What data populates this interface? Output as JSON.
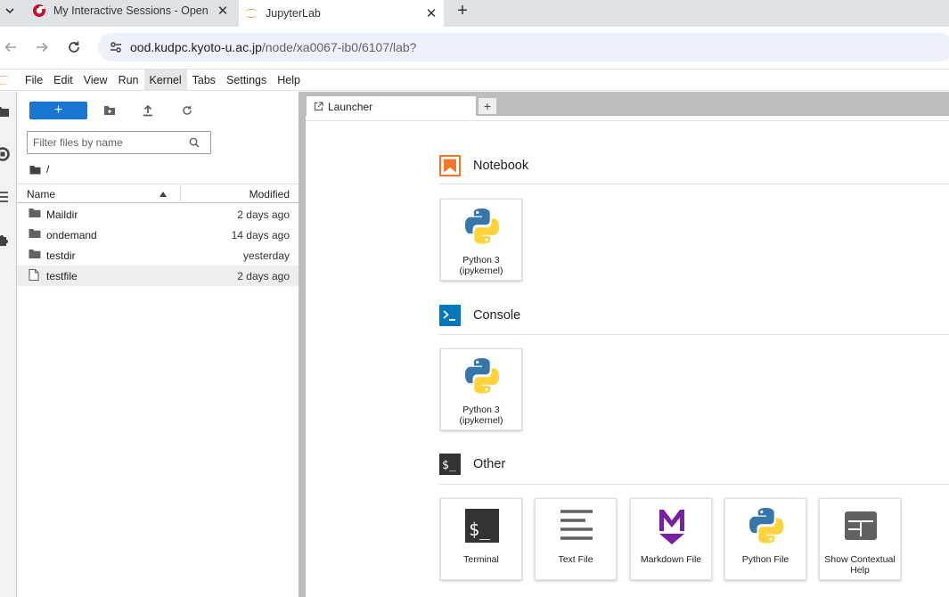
{
  "browser": {
    "tabs": [
      {
        "title": "My Interactive Sessions - Open",
        "active": false
      },
      {
        "title": "JupyterLab",
        "active": true
      }
    ],
    "url_host": "ood.kudpc.kyoto-u.ac.jp",
    "url_path": "/node/xa0067-ib0/6107/lab?"
  },
  "menubar": {
    "items": [
      "File",
      "Edit",
      "View",
      "Run",
      "Kernel",
      "Tabs",
      "Settings",
      "Help"
    ],
    "active": "Kernel"
  },
  "filebrowser": {
    "new_label": "+",
    "filter_placeholder": "Filter files by name",
    "breadcrumb": "/",
    "columns": {
      "name": "Name",
      "modified": "Modified"
    },
    "files": [
      {
        "name": "Maildir",
        "type": "folder",
        "modified": "2 days ago"
      },
      {
        "name": "ondemand",
        "type": "folder",
        "modified": "14 days ago"
      },
      {
        "name": "testdir",
        "type": "folder",
        "modified": "yesterday"
      },
      {
        "name": "testfile",
        "type": "file",
        "modified": "2 days ago",
        "selected": true
      }
    ]
  },
  "dock": {
    "tab_label": "Launcher",
    "add_tab": "+"
  },
  "launcher": {
    "notebook": {
      "heading": "Notebook",
      "kernel_label": "Python 3 (ipykernel)"
    },
    "console": {
      "heading": "Console",
      "kernel_label": "Python 3 (ipykernel)"
    },
    "other": {
      "heading": "Other",
      "items": [
        "Terminal",
        "Text File",
        "Markdown File",
        "Python File",
        "Show Contextual Help"
      ]
    }
  },
  "colors": {
    "accent": "#1976d2",
    "notebook_icon": "#f37726",
    "console_icon": "#0277bd",
    "markdown_icon": "#7b1fa2",
    "python_blue": "#3776ab",
    "python_yellow": "#ffd43b"
  }
}
